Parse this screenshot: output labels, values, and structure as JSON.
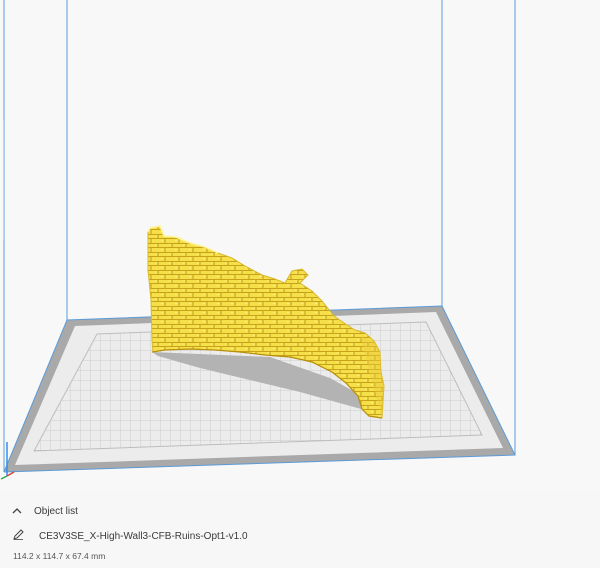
{
  "viewport": {
    "model_color": "#f5e04a",
    "model_shadow_color": "#b3b3b3",
    "volume_edge_color": "#5a9bd8"
  },
  "object_list": {
    "header_label": "Object list",
    "collapse_icon": "chevron-up-icon",
    "edit_icon": "pencil-icon",
    "object_name": "CE3V3SE_X-High-Wall3-CFB-Ruins-Opt1-v1.0",
    "dimensions": "114.2 x 114.7 x 67.4 mm"
  }
}
